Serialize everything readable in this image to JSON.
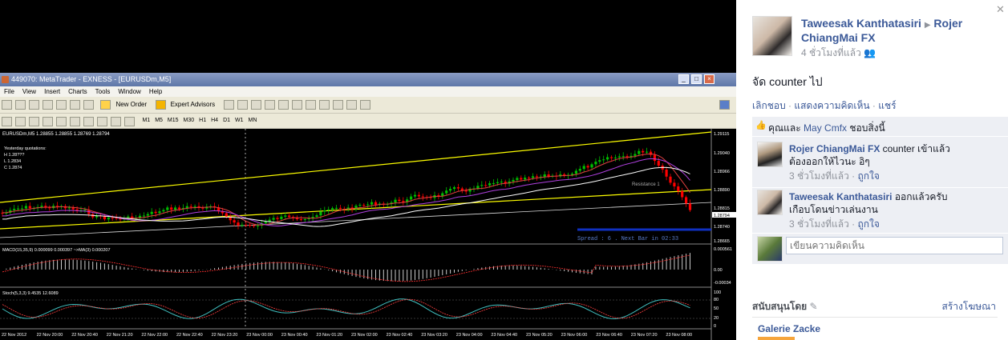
{
  "mt4": {
    "title": "449070: MetaTrader - EXNESS - [EURUSDm,M5]",
    "menu": [
      "File",
      "View",
      "Insert",
      "Charts",
      "Tools",
      "Window",
      "Help"
    ],
    "toolbar": {
      "new_order": "New Order",
      "expert_advisors": "Expert Advisors"
    },
    "timeframes": [
      "M1",
      "M5",
      "M15",
      "M30",
      "H1",
      "H4",
      "D1",
      "W1",
      "MN"
    ],
    "chart_header": "EURUSDm,M5  1.28855 1.28855 1.28769 1.28794",
    "yesterday": [
      "Yesterday quotations:",
      "H 1.28???  ",
      "L 1.2834",
      "C 1.2874"
    ],
    "spread_text": "Spread : 6 . Next Bar in 02:33",
    "macd_label": "MACD(15,35,9) 0.000099 0.000397  ~>MA(3) 0.000207",
    "stoch_label": "Stoch(5,3,3) 9.4535 12.6089",
    "resistance_label": "Resistance 1",
    "price_ticks": [
      "1.29115",
      "1.29040",
      "1.28966",
      "1.28890",
      "1.28815",
      "1.28740",
      "1.28665"
    ],
    "price_badge": "1.28794",
    "macd_ticks": [
      "0.000561",
      "0.00",
      "-0.00034"
    ],
    "stoch_ticks": [
      "100",
      "80",
      "50",
      "20",
      "0"
    ],
    "time_ticks": [
      "22 Nov 2012",
      "22 Nov 20:00",
      "22 Nov 20:40",
      "22 Nov 21:20",
      "22 Nov 22:00",
      "22 Nov 22:40",
      "22 Nov 23:20",
      "23 Nov 00:00",
      "23 Nov 00:40",
      "23 Nov 01:20",
      "23 Nov 02:00",
      "23 Nov 02:40",
      "23 Nov 03:20",
      "23 Nov 04:00",
      "23 Nov 04:40",
      "23 Nov 05:20",
      "23 Nov 06:00",
      "23 Nov 06:40",
      "23 Nov 07:20",
      "23 Nov 08:00"
    ]
  },
  "post": {
    "author": "Taweesak Kanthatasiri",
    "target": "Rojer ChiangMai FX",
    "time": "4 ชั่วโมงที่แล้ว",
    "text": "จัด counter ไป",
    "actions": [
      "เลิกชอบ",
      "แสดงความคิดเห็น",
      "แชร์"
    ],
    "likes_prefix": "คุณและ",
    "likes_name": "May Cmfx",
    "likes_suffix": "ชอบสิ่งนี้"
  },
  "comments": [
    {
      "author": "Rojer ChiangMai FX",
      "text1": " counter เข้าแล้ว",
      "text2": "ต้องออกให้ไวนะ อิๆ",
      "time": "3 ชั่วโมงที่แล้ว",
      "like": "ถูกใจ"
    },
    {
      "author": "Taweesak Kanthatasiri",
      "text1": " ออกแล้วครับ",
      "text2": "เกือบโดนข่าวเล่นงาน",
      "time": "3 ชั่วโมงที่แล้ว",
      "like": "ถูกใจ"
    }
  ],
  "comment_input": {
    "placeholder": "เขียนความคิดเห็น"
  },
  "sponsored": {
    "title": "สนับสนุนโดย",
    "create": "สร้างโฆษณา",
    "ad_name": "Galerie Zacke"
  },
  "colors": {
    "fb_link": "#3b5998",
    "chart_bg": "#000000",
    "bull": "#00c000",
    "bear": "#ff0000",
    "trend": "#ffff00"
  }
}
